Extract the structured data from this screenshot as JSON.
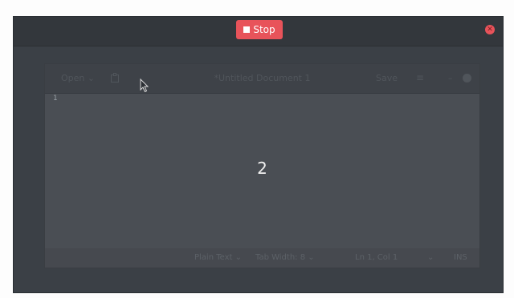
{
  "recorder": {
    "stop_label": "Stop",
    "icons": {
      "stop": "stop-square-icon",
      "close": "close-icon"
    },
    "accent_color": "#e8535a"
  },
  "editor": {
    "open_label": "Open",
    "title": "*Untitled Document 1",
    "save_label": "Save",
    "menu_icon": "≡",
    "minimize_icon": "–",
    "line_number": "1",
    "countdown": "2",
    "status": {
      "language": "Plain Text",
      "tab_width": "Tab Width: 8",
      "position": "Ln 1, Col 1",
      "mode": "INS"
    }
  }
}
